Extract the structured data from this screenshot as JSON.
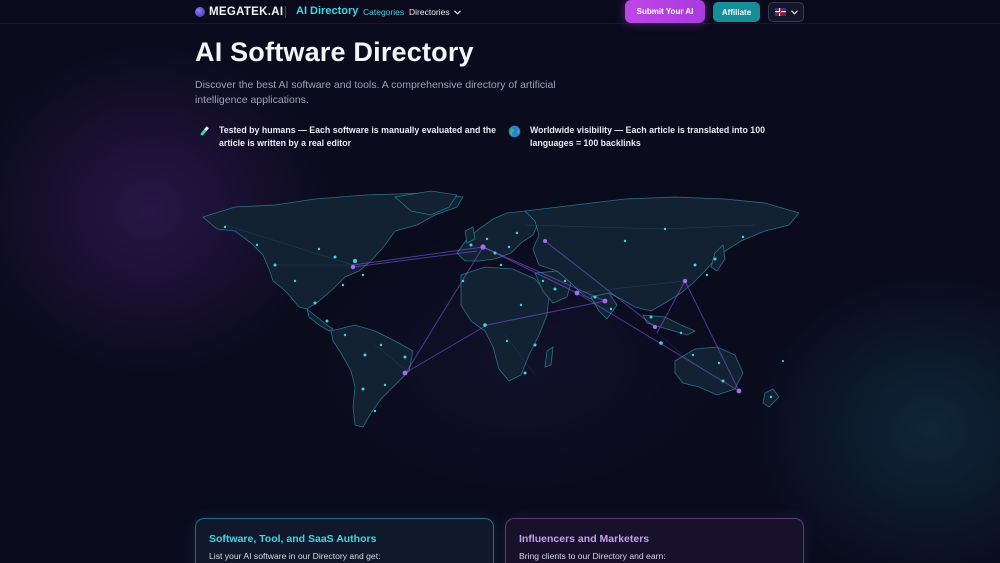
{
  "header": {
    "logo_text": "MEGATEK.AI",
    "brand_link": "AI Directory",
    "nav": {
      "categories": "Categories",
      "directories": "Directories"
    },
    "submit_label": "Submit Your AI",
    "affiliate_label": "Affiliate",
    "language_icon": "uk-flag-icon"
  },
  "hero": {
    "title": "AI Software Directory",
    "subtitle": "Discover the best AI software and tools. A comprehensive directory of artificial intelligence applications.",
    "features": [
      {
        "icon": "test-tube-icon",
        "text": "Tested by humans — Each software is manually evaluated and the article is written by a real editor"
      },
      {
        "icon": "globe-icon",
        "text": "Worldwide visibility — Each article is translated into 100 languages = 100 backlinks"
      }
    ]
  },
  "cards": [
    {
      "title": "Software, Tool, and SaaS Authors",
      "text": "List your AI software in our Directory and get:"
    },
    {
      "title": "Influencers and Marketers",
      "text": "Bring clients to our Directory and earn:"
    }
  ],
  "colors": {
    "accent_cyan": "#3fd6e6",
    "accent_purple": "#c045e8",
    "background": "#0a0b1c"
  }
}
